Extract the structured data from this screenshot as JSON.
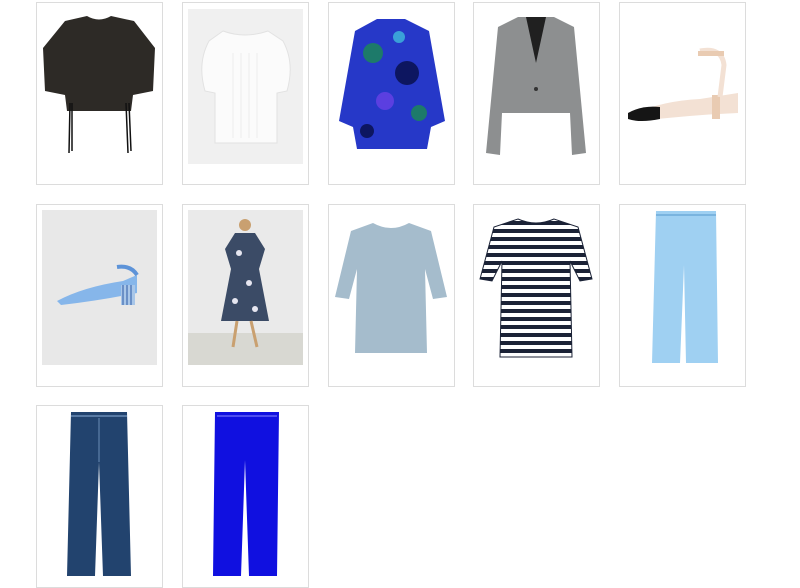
{
  "catalog": {
    "items": [
      {
        "name": "black-cropped-top",
        "bg": "#ffffff"
      },
      {
        "name": "white-puff-sleeve-top",
        "bg": "#f0f0f0"
      },
      {
        "name": "blue-floral-blouse",
        "bg": "#ffffff"
      },
      {
        "name": "grey-blazer",
        "bg": "#ffffff"
      },
      {
        "name": "cream-slingback-heels",
        "bg": "#ffffff"
      },
      {
        "name": "blue-slingback-pumps",
        "bg": "#e8e8e8"
      },
      {
        "name": "floral-wrap-dress",
        "bg": "#eaeaea"
      },
      {
        "name": "light-blue-tshirt",
        "bg": "#ffffff"
      },
      {
        "name": "striped-tshirt",
        "bg": "#ffffff"
      },
      {
        "name": "light-blue-trousers",
        "bg": "#ffffff"
      },
      {
        "name": "dark-denim-jeans",
        "bg": "#ffffff"
      },
      {
        "name": "cobalt-blue-trousers",
        "bg": "#ffffff"
      }
    ]
  }
}
